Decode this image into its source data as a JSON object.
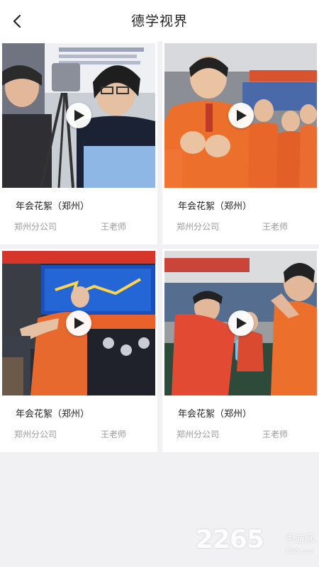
{
  "header": {
    "title": "德学视界",
    "back_icon": "chevron-left-icon"
  },
  "videos": [
    {
      "title": "年会花絮（郑州）",
      "company": "郑州分公司",
      "teacher": "王老师",
      "icon": "play-icon"
    },
    {
      "title": "年会花絮（郑州）",
      "company": "郑州分公司",
      "teacher": "王老师",
      "icon": "play-icon"
    },
    {
      "title": "年会花絮（郑州）",
      "company": "郑州分公司",
      "teacher": "王老师",
      "icon": "play-icon"
    },
    {
      "title": "年会花絮（郑州）",
      "company": "郑州分公司",
      "teacher": "王老师",
      "icon": "play-icon"
    }
  ],
  "watermark": {
    "number": "2265",
    "text": "手游网",
    "url": "2265.com"
  },
  "colors": {
    "background": "#f1f1f4",
    "card": "#ffffff",
    "accent_orange": "#e8622a",
    "text": "#222222",
    "muted": "#9a9a9a"
  }
}
